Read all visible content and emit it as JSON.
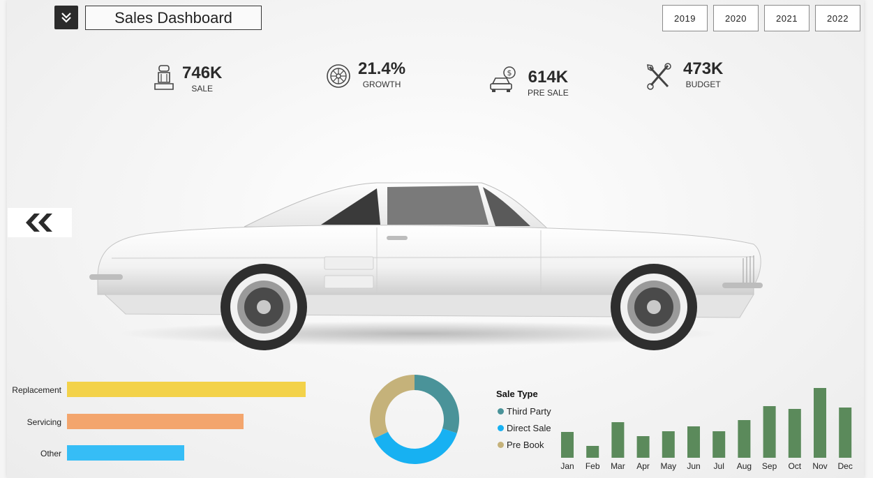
{
  "header": {
    "title": "Sales Dashboard",
    "menu_icon": "double-chevron-down-icon",
    "years": [
      "2019",
      "2020",
      "2021",
      "2022"
    ]
  },
  "kpis": [
    {
      "icon": "car-seat-icon",
      "value": "746K",
      "label": "SALE"
    },
    {
      "icon": "tire-icon",
      "value": "21.4%",
      "label": "GROWTH"
    },
    {
      "icon": "car-dollar-icon",
      "value": "614K",
      "label": "PRE SALE"
    },
    {
      "icon": "tools-icon",
      "value": "473K",
      "label": "BUDGET"
    }
  ],
  "nav": {
    "back_icon": "double-chevron-left-icon"
  },
  "colors": {
    "replacement": "#f3d24a",
    "servicing": "#f3a56d",
    "other": "#36bdf6",
    "third_party": "#4a9399",
    "direct_sale": "#17b1f2",
    "pre_book": "#c5b27a",
    "monthly": "#5b8a5b"
  },
  "chart_data": [
    {
      "type": "bar",
      "orientation": "horizontal",
      "categories": [
        "Replacement",
        "Servicing",
        "Other"
      ],
      "values": [
        100,
        74,
        49
      ],
      "xlim": [
        0,
        100
      ]
    },
    {
      "type": "pie",
      "donut": true,
      "legend_title": "Sale Type",
      "categories": [
        "Third Party",
        "Direct Sale",
        "Pre Book"
      ],
      "values": [
        30,
        38,
        32
      ],
      "legend_position": "right"
    },
    {
      "type": "bar",
      "categories": [
        "Jan",
        "Feb",
        "Mar",
        "Apr",
        "May",
        "Jun",
        "Jul",
        "Aug",
        "Sep",
        "Oct",
        "Nov",
        "Dec"
      ],
      "values": [
        37,
        17,
        51,
        31,
        38,
        45,
        38,
        54,
        74,
        70,
        100,
        72
      ],
      "ylim": [
        0,
        100
      ]
    }
  ]
}
